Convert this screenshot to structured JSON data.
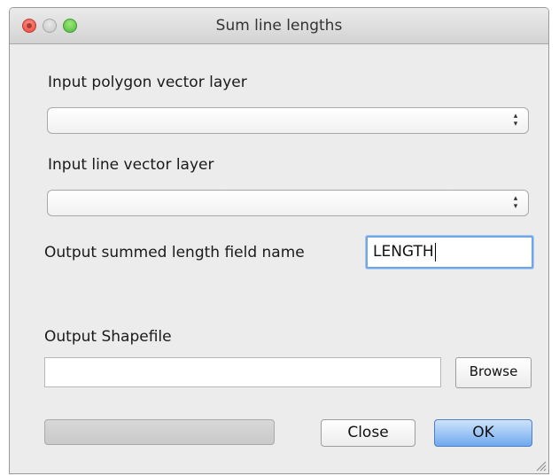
{
  "window": {
    "title": "Sum line lengths"
  },
  "polygon_layer": {
    "label": "Input polygon vector layer",
    "value": ""
  },
  "line_layer": {
    "label": "Input line vector layer",
    "value": ""
  },
  "field_name": {
    "label": "Output summed length field name",
    "value": "LENGTH"
  },
  "output": {
    "label": "Output Shapefile",
    "value": "",
    "browse_label": "Browse"
  },
  "progress": {
    "value": 0
  },
  "buttons": {
    "close_label": "Close",
    "ok_label": "OK"
  },
  "colors": {
    "focus_ring": "#6ea6e8",
    "default_button": "#6fa9ef",
    "window_bg": "#ececec"
  },
  "icons": [
    "close-window-icon",
    "minimize-window-icon",
    "zoom-window-icon",
    "up-down-arrows-icon",
    "resize-grip-icon"
  ]
}
